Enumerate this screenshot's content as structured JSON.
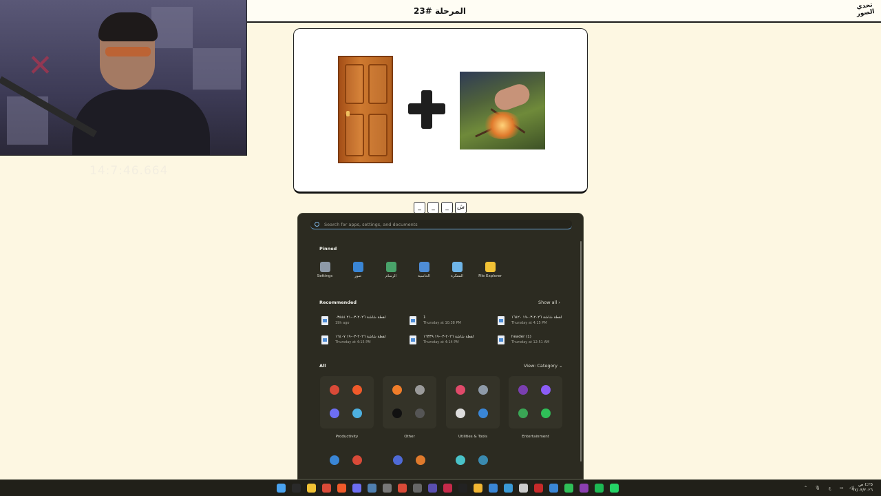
{
  "header": {
    "level_title": "المرحلة #23",
    "logo_line1": "تحدي",
    "logo_line2": "الصور"
  },
  "overlay": {
    "timer_ghost": "14:7:46.664"
  },
  "puzzle": {
    "left_image": "door-image",
    "operator": "plus-icon",
    "right_image": "fire-image"
  },
  "answer": {
    "slots": [
      "_",
      "_",
      "_",
      "ش"
    ]
  },
  "start_menu": {
    "search_placeholder": "Search for apps, settings, and documents",
    "pinned_label": "Pinned",
    "pinned": [
      {
        "label": "Settings",
        "icon": "settings-icon",
        "color": "#8e9aa8"
      },
      {
        "label": "صور",
        "icon": "photos-icon",
        "color": "#3a86d6"
      },
      {
        "label": "الرسام",
        "icon": "paint-icon",
        "color": "#49a36a"
      },
      {
        "label": "الحاسبة",
        "icon": "calculator-icon",
        "color": "#4e8dd6"
      },
      {
        "label": "المفكرة",
        "icon": "notepad-icon",
        "color": "#6fb5e8"
      },
      {
        "label": "File Explorer",
        "icon": "folder-icon",
        "color": "#f2c235"
      }
    ],
    "recommended_label": "Recommended",
    "show_all": "Show all",
    "recommended": [
      {
        "name": "لقطة شاشة ٢٠٢٦-٠٣-٢١ ٠٣٤٤٤",
        "time": "19h ago"
      },
      {
        "name": "1",
        "time": "Thursday at 10:38 PM"
      },
      {
        "name": "لقطة شاشة ٢٠٢٦-٠٣-١٩ ١٦٤٢٠",
        "time": "Thursday at 4:15 PM"
      },
      {
        "name": "لقطة شاشة ٢٠٢٦-٠٣-١٩ ١٦٤٠٧",
        "time": "Thursday at 4:15 PM"
      },
      {
        "name": "لقطة شاشة ٢٠٢٦-٠٣-١٩ ١٦٣٣٩",
        "time": "Thursday at 4:14 PM"
      },
      {
        "name": "header (1)",
        "time": "Thursday at 12:51 AM"
      }
    ],
    "all_label": "All",
    "view_category": "View: Category",
    "categories": [
      {
        "label": "Productivity",
        "icons": [
          "#d94a38",
          "#f05a2a",
          "#6d6ef2",
          "#4db0e0"
        ]
      },
      {
        "label": "Other",
        "icons": [
          "#f07d2a",
          "#9a9a9a",
          "#111111",
          "#555555"
        ]
      },
      {
        "label": "Utilities & Tools",
        "icons": [
          "#e04a6a",
          "#8e9aa8",
          "#dddddd",
          "#3a86d6"
        ]
      },
      {
        "label": "Entertainment",
        "icons": [
          "#7a3fb0",
          "#8b5cf6",
          "#3aa655",
          "#2fbf58"
        ]
      }
    ],
    "more_icons": [
      "#3a86d6",
      "#d94a38",
      "#4f6ad6",
      "#e07a2c",
      "#49c2c8",
      "#3a8ab0"
    ]
  },
  "taskbar": {
    "icons": [
      {
        "name": "start-icon",
        "color": "#4aa3f0"
      },
      {
        "name": "search-icon",
        "color": "#2a2a2a"
      },
      {
        "name": "file-explorer-icon",
        "color": "#f2c235"
      },
      {
        "name": "chrome-icon",
        "color": "#d94a38"
      },
      {
        "name": "brave-icon",
        "color": "#f05a2a"
      },
      {
        "name": "discord-icon",
        "color": "#6d6ef2"
      },
      {
        "name": "steam-icon",
        "color": "#4f7fb0"
      },
      {
        "name": "tool-icon",
        "color": "#777777"
      },
      {
        "name": "chrome-alt-icon",
        "color": "#d94a38"
      },
      {
        "name": "obs-icon",
        "color": "#666666"
      },
      {
        "name": "video-icon",
        "color": "#5a4fb0"
      },
      {
        "name": "adobe-icon",
        "color": "#c62a4a"
      },
      {
        "name": "capcut-icon",
        "color": "#222222"
      },
      {
        "name": "app-yellow-icon",
        "color": "#f2b632"
      },
      {
        "name": "photos-taskbar-icon",
        "color": "#3a86d6"
      },
      {
        "name": "kodi-icon",
        "color": "#3a9ad6"
      },
      {
        "name": "vpn-icon",
        "color": "#cccccc"
      },
      {
        "name": "app-red-icon",
        "color": "#c62a2a"
      },
      {
        "name": "azure-icon",
        "color": "#3a86d6"
      },
      {
        "name": "edge-icon",
        "color": "#2fbf58"
      },
      {
        "name": "twitch-icon",
        "color": "#8b3fb0"
      },
      {
        "name": "spotify-icon",
        "color": "#1db954"
      },
      {
        "name": "whatsapp-icon",
        "color": "#25d366"
      }
    ],
    "tray_lang": "ع",
    "time": "٤:٢٥ ص",
    "date": "٢٧/٠٣/٢٠٢٦"
  }
}
